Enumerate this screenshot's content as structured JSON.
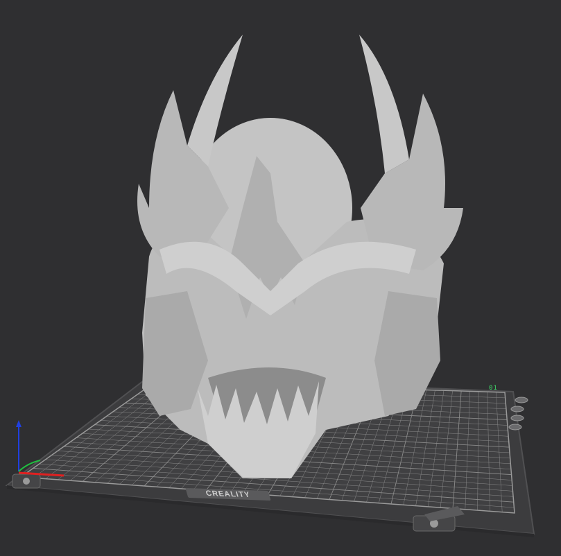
{
  "viewport": {
    "background": "#2f2f31",
    "plate": {
      "id_label": "01",
      "brand": "CREALITY",
      "grid_color": "#8a8a8a",
      "frame_color": "#3c3c3e"
    },
    "model": {
      "color": "#bdbdbd",
      "shadow_color": "#8c8c8c"
    },
    "axes": {
      "x_color": "#e02020",
      "y_color": "#20c040",
      "z_color": "#2040e0"
    },
    "icons": [
      "plate-settings-icon",
      "plate-lock-icon",
      "plate-arrange-icon",
      "plate-orient-icon"
    ]
  }
}
